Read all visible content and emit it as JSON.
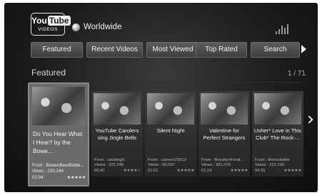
{
  "header": {
    "logo_top": "You",
    "logo_top_box": "Tube",
    "logo_bottom": "VIDEOS",
    "region": "Worldwide"
  },
  "nav": {
    "tabs": [
      "Featured",
      "Recent Videos",
      "Most Viewed",
      "Top Rated",
      "Search"
    ]
  },
  "section": {
    "title": "Featured",
    "page": "1 / 71"
  },
  "videos": [
    {
      "title": "Do You Hear What I Hear? by the Bowe...",
      "from": "From : BowenBeerBottle...",
      "views": "Views : 220,244",
      "duration": "01:04",
      "stars": "★★★★★"
    },
    {
      "title": "YouTube Carolers sing Jingle Bells",
      "from": "From : carolingS",
      "views": "Views : 222,340",
      "duration": "00:40",
      "stars": "★★★★☆"
    },
    {
      "title": "Silent Night",
      "from": "From : carmen75013",
      "views": "Views : 60,097",
      "duration": "01:01",
      "stars": "★★★★★"
    },
    {
      "title": "Valentine for Perfect Strangers",
      "from": "From : BrooklynFeral...",
      "views": "Views : 281,076",
      "duration": "01:19",
      "stars": "★★★★★"
    },
    {
      "title": "Usher* Love in This Club* The Rock-...",
      "from": "From : therockafire",
      "views": "Views : 222,230",
      "duration": "04:35",
      "stars": "★★★★★"
    }
  ]
}
